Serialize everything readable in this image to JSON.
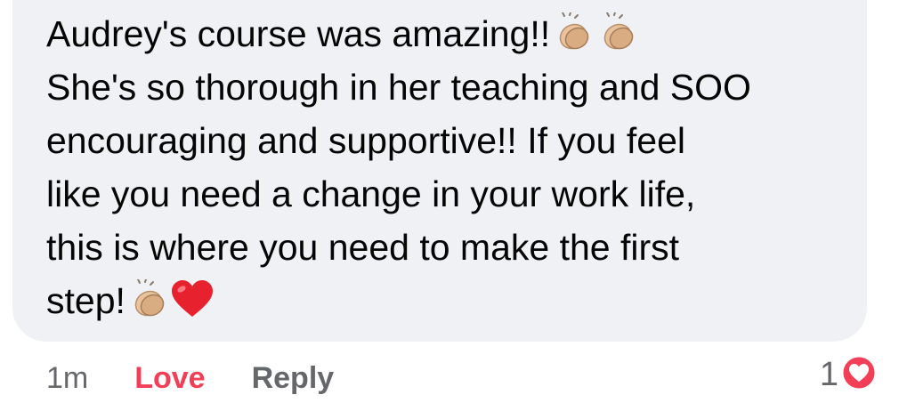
{
  "comment": {
    "lines": [
      "Audrey's course was amazing!!",
      "She's so thorough in her teaching and SOO",
      "encouraging and supportive!! If you feel",
      "like you need a change in your work life,",
      "this is where you need to make the first",
      "step!"
    ],
    "emojis": [
      "clapping-hands-icon",
      "clapping-hands-icon",
      "clapping-hands-icon",
      "red-heart-icon"
    ]
  },
  "actions": {
    "timestamp": "1m",
    "love_label": "Love",
    "reply_label": "Reply"
  },
  "reaction": {
    "count": "1",
    "icon": "love-reaction-icon"
  },
  "colors": {
    "bubble": "#f0f1f5",
    "text": "#050505",
    "secondary": "#65676b",
    "love": "#f33e58"
  }
}
